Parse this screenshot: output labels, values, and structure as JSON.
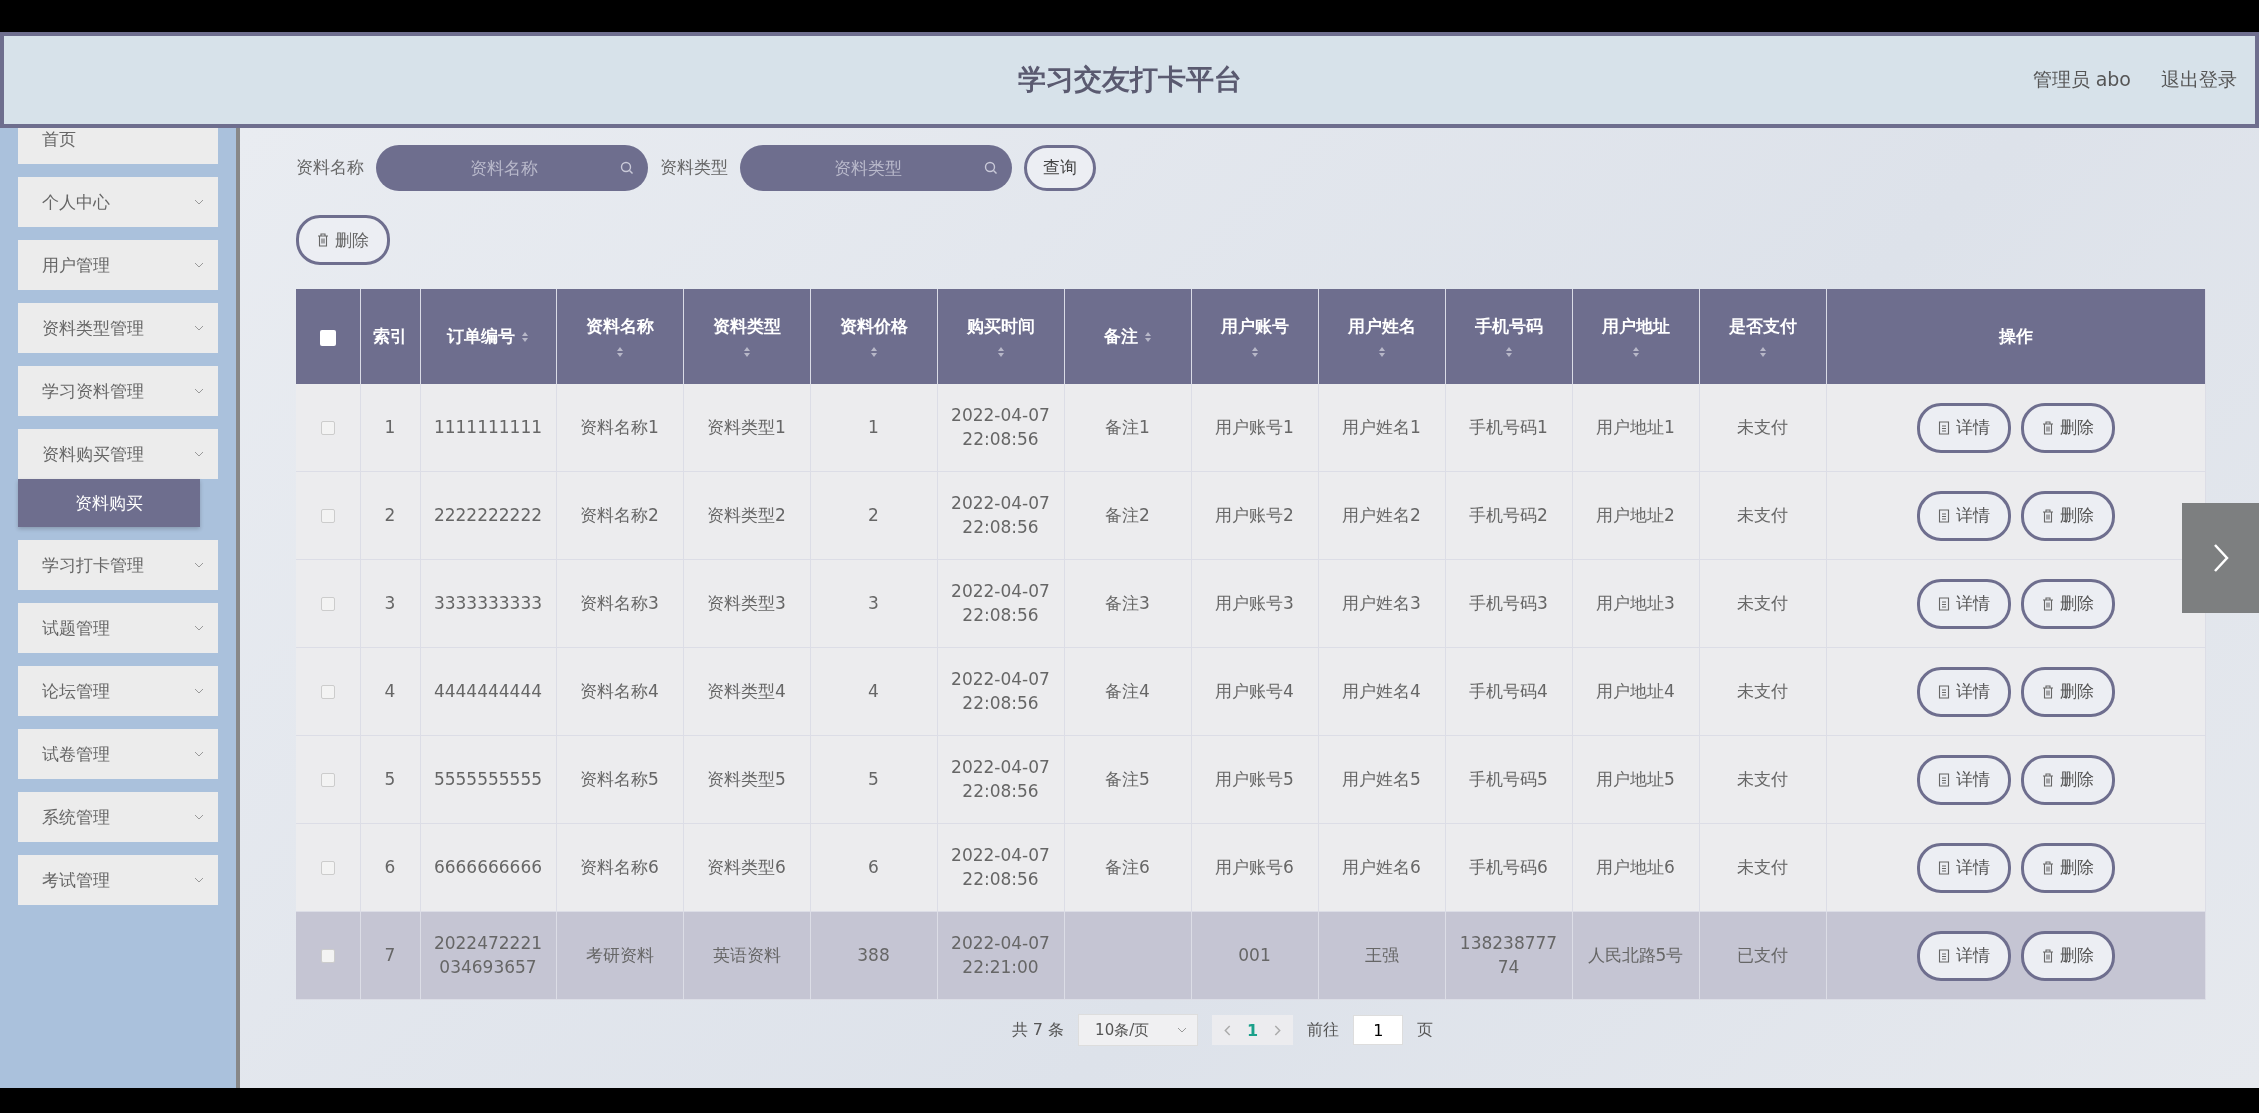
{
  "header": {
    "title": "学习交友打卡平台",
    "user": "管理员 abo",
    "logout": "退出登录"
  },
  "sidebar": {
    "items": [
      {
        "label": "首页",
        "expandable": false
      },
      {
        "label": "个人中心",
        "expandable": true,
        "expanded": false
      },
      {
        "label": "用户管理",
        "expandable": true,
        "expanded": false
      },
      {
        "label": "资料类型管理",
        "expandable": true,
        "expanded": false
      },
      {
        "label": "学习资料管理",
        "expandable": true,
        "expanded": false
      },
      {
        "label": "资料购买管理",
        "expandable": true,
        "expanded": true,
        "children": [
          {
            "label": "资料购买",
            "selected": true
          }
        ]
      },
      {
        "label": "学习打卡管理",
        "expandable": true,
        "expanded": false
      },
      {
        "label": "试题管理",
        "expandable": true,
        "expanded": false
      },
      {
        "label": "论坛管理",
        "expandable": true,
        "expanded": false
      },
      {
        "label": "试卷管理",
        "expandable": true,
        "expanded": false
      },
      {
        "label": "系统管理",
        "expandable": true,
        "expanded": false
      },
      {
        "label": "考试管理",
        "expandable": true,
        "expanded": false
      }
    ]
  },
  "search": {
    "fields": [
      {
        "label": "资料名称",
        "placeholder": "资料名称"
      },
      {
        "label": "资料类型",
        "placeholder": "资料类型"
      }
    ],
    "button": "查询"
  },
  "toolbar": {
    "delete_button": "删除"
  },
  "table": {
    "all_checked": false,
    "columns": [
      {
        "label": "索引",
        "kind": "plain"
      },
      {
        "label": "订单编号",
        "kind": "inline"
      },
      {
        "label": "资料名称",
        "kind": "stacked"
      },
      {
        "label": "资料类型",
        "kind": "stacked"
      },
      {
        "label": "资料价格",
        "kind": "stacked"
      },
      {
        "label": "购买时间",
        "kind": "stacked"
      },
      {
        "label": "备注",
        "kind": "inline"
      },
      {
        "label": "用户账号",
        "kind": "stacked"
      },
      {
        "label": "用户姓名",
        "kind": "stacked"
      },
      {
        "label": "手机号码",
        "kind": "stacked"
      },
      {
        "label": "用户地址",
        "kind": "stacked"
      },
      {
        "label": "是否支付",
        "kind": "stacked"
      },
      {
        "label": "操作",
        "kind": "plain"
      }
    ],
    "rows": [
      {
        "checked": false,
        "selected": false,
        "cells": [
          "1",
          "1111111111",
          "资料名称1",
          "资料类型1",
          "1",
          "2022-04-07 22:08:56",
          "备注1",
          "用户账号1",
          "用户姓名1",
          "手机号码1",
          "用户地址1",
          "未支付"
        ],
        "actions": [
          "详情",
          "删除"
        ]
      },
      {
        "checked": false,
        "selected": false,
        "cells": [
          "2",
          "2222222222",
          "资料名称2",
          "资料类型2",
          "2",
          "2022-04-07 22:08:56",
          "备注2",
          "用户账号2",
          "用户姓名2",
          "手机号码2",
          "用户地址2",
          "未支付"
        ],
        "actions": [
          "详情",
          "删除"
        ]
      },
      {
        "checked": false,
        "selected": false,
        "cells": [
          "3",
          "3333333333",
          "资料名称3",
          "资料类型3",
          "3",
          "2022-04-07 22:08:56",
          "备注3",
          "用户账号3",
          "用户姓名3",
          "手机号码3",
          "用户地址3",
          "未支付"
        ],
        "actions": [
          "详情",
          "删除"
        ]
      },
      {
        "checked": false,
        "selected": false,
        "cells": [
          "4",
          "4444444444",
          "资料名称4",
          "资料类型4",
          "4",
          "2022-04-07 22:08:56",
          "备注4",
          "用户账号4",
          "用户姓名4",
          "手机号码4",
          "用户地址4",
          "未支付"
        ],
        "actions": [
          "详情",
          "删除"
        ]
      },
      {
        "checked": false,
        "selected": false,
        "cells": [
          "5",
          "5555555555",
          "资料名称5",
          "资料类型5",
          "5",
          "2022-04-07 22:08:56",
          "备注5",
          "用户账号5",
          "用户姓名5",
          "手机号码5",
          "用户地址5",
          "未支付"
        ],
        "actions": [
          "详情",
          "删除"
        ]
      },
      {
        "checked": false,
        "selected": false,
        "cells": [
          "6",
          "6666666666",
          "资料名称6",
          "资料类型6",
          "6",
          "2022-04-07 22:08:56",
          "备注6",
          "用户账号6",
          "用户姓名6",
          "手机号码6",
          "用户地址6",
          "未支付"
        ],
        "actions": [
          "详情",
          "删除"
        ]
      },
      {
        "checked": false,
        "selected": true,
        "cells": [
          "7",
          "2022472221034693657",
          "考研资料",
          "英语资料",
          "388",
          "2022-04-07 22:21:00",
          "",
          "001",
          "王强",
          "13823877774",
          "人民北路5号",
          "已支付"
        ],
        "actions": [
          "详情",
          "删除"
        ]
      }
    ]
  },
  "pagination": {
    "total": "共 7 条",
    "page_size": "10条/页",
    "pages": [
      {
        "label": "1",
        "selected": true
      }
    ],
    "goto_label": "前往",
    "goto_value": "1",
    "goto_suffix": "页"
  }
}
